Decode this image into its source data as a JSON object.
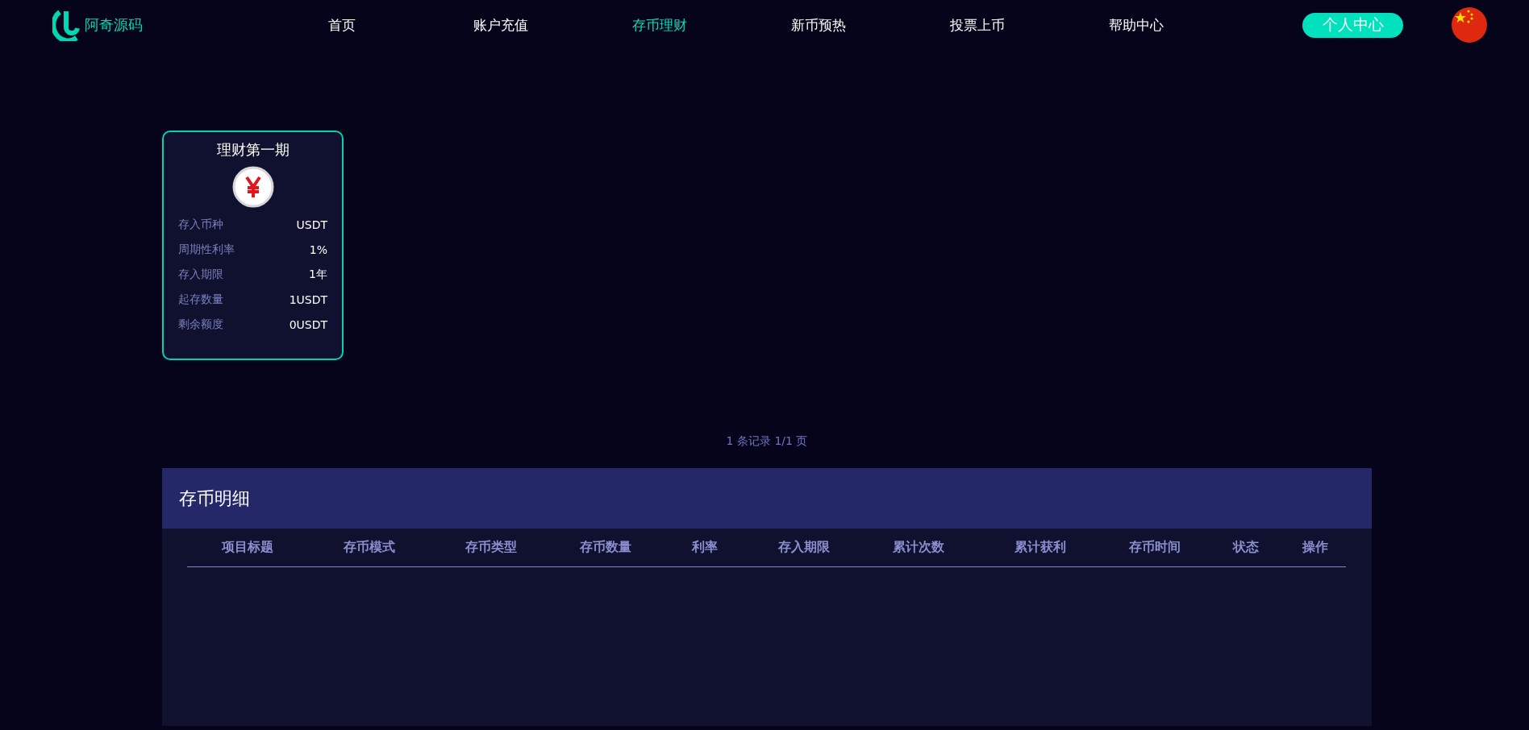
{
  "brand": {
    "name": "阿奇源码"
  },
  "nav": [
    {
      "label": "首页",
      "selected": false
    },
    {
      "label": "账户充值",
      "selected": false
    },
    {
      "label": "存币理财",
      "selected": true
    },
    {
      "label": "新币预热",
      "selected": false
    },
    {
      "label": "投票上币",
      "selected": false
    },
    {
      "label": "帮助中心",
      "selected": false
    }
  ],
  "user_button": "个人中心",
  "products": [
    {
      "title": "理财第一期",
      "rows": [
        {
          "label": "存入币种",
          "value": "USDT"
        },
        {
          "label": "周期性利率",
          "value": "1%"
        },
        {
          "label": "存入期限",
          "value": "1年"
        },
        {
          "label": "起存数量",
          "value": "1USDT"
        },
        {
          "label": "剩余额度",
          "value": "0USDT"
        }
      ]
    }
  ],
  "pagination": "1 条记录 1/1 页",
  "details": {
    "title": "存币明细",
    "columns": [
      "项目标题",
      "存币模式",
      "存币类型",
      "存币数量",
      "利率",
      "存入期限",
      "累计次数",
      "累计获利",
      "存币时间",
      "状态",
      "操作"
    ]
  }
}
